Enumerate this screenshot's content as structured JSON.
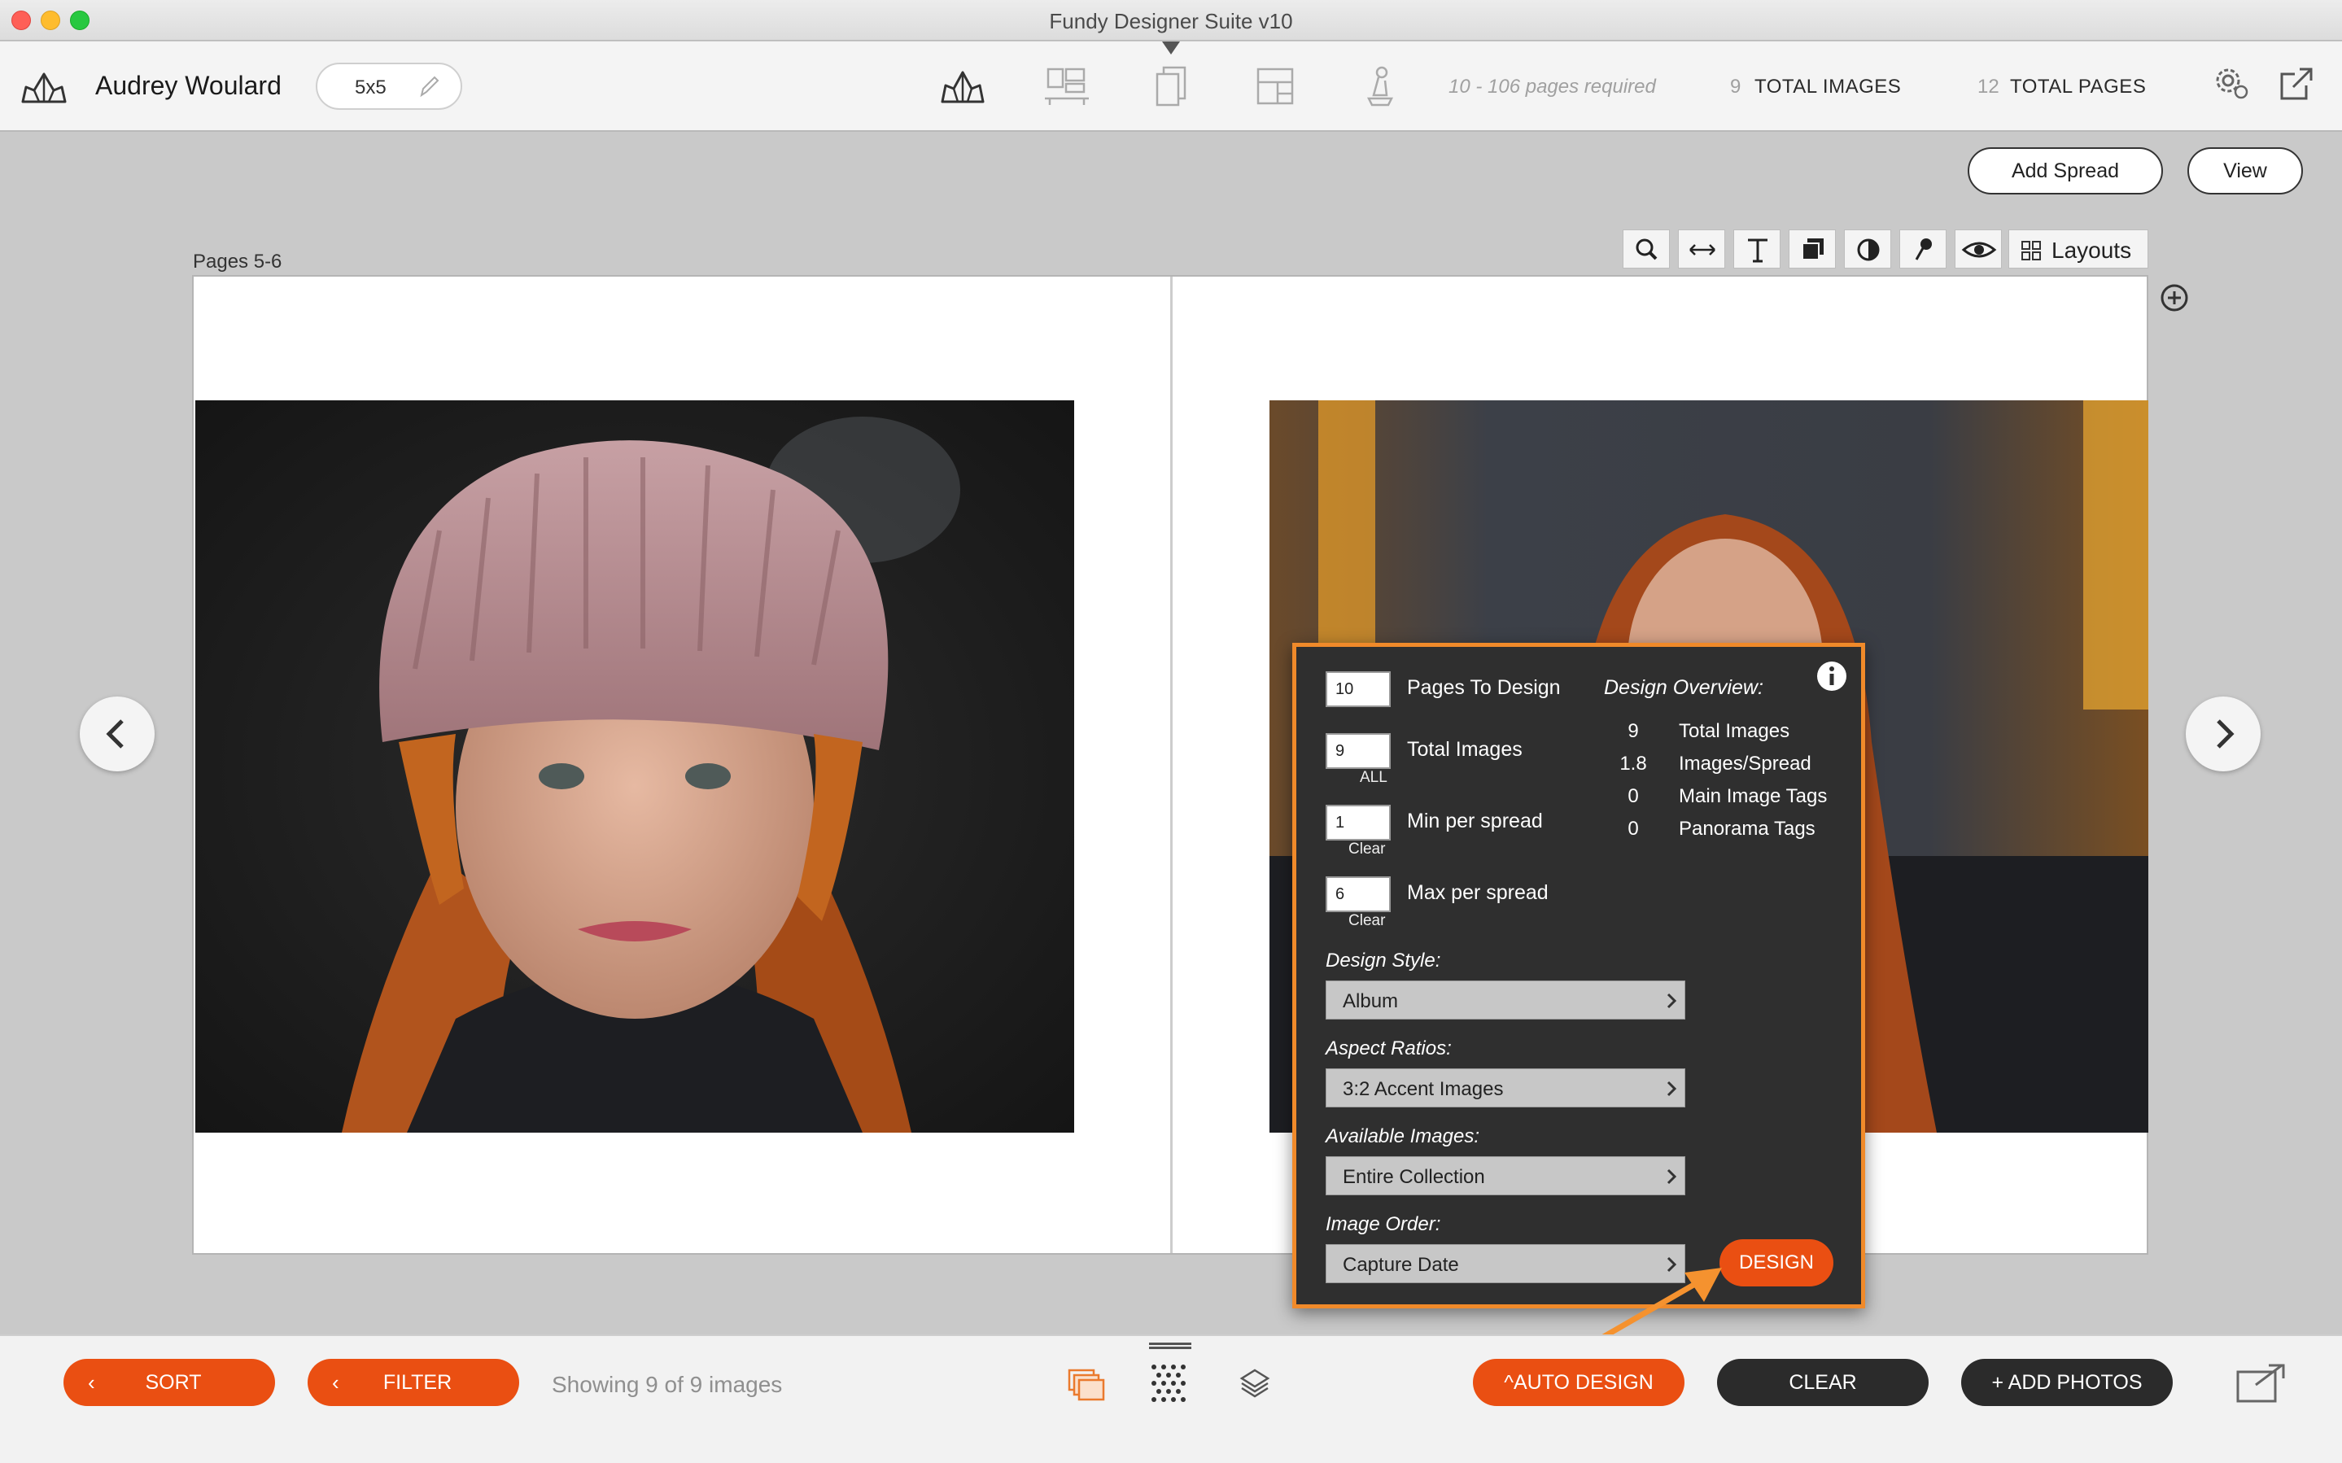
{
  "window": {
    "title": "Fundy Designer Suite v10"
  },
  "toolbar": {
    "client_name": "Audrey Woulard",
    "album_size": "5x5",
    "pages_required": "10 - 106 pages required",
    "total_images_count": "9",
    "total_images_label": "TOTAL IMAGES",
    "total_pages_count": "12",
    "total_pages_label": "TOTAL PAGES",
    "icons": [
      "album-designer-icon",
      "wall-art-icon",
      "proofing-icon",
      "cards-icon",
      "uploader-icon",
      "settings-icon",
      "export-icon"
    ]
  },
  "actions": {
    "add_spread": "Add Spread",
    "view": "View"
  },
  "spread": {
    "label": "Pages 5-6"
  },
  "tools": {
    "layouts_label": "Layouts",
    "icons": [
      "zoom-icon",
      "swap-icon",
      "text-icon",
      "layer-icon",
      "color-icon",
      "pin-icon",
      "eye-icon",
      "layouts-grid-icon"
    ]
  },
  "auto_design": {
    "pages_to_design": {
      "value": "10",
      "label": "Pages To Design"
    },
    "total_images": {
      "value": "9",
      "label": "Total Images",
      "sub": "ALL"
    },
    "min_per_spread": {
      "value": "1",
      "label": "Min per spread",
      "sub": "Clear"
    },
    "max_per_spread": {
      "value": "6",
      "label": "Max per spread",
      "sub": "Clear"
    },
    "overview": {
      "title": "Design Overview:",
      "rows": [
        {
          "value": "9",
          "label": "Total Images"
        },
        {
          "value": "1.8",
          "label": "Images/Spread"
        },
        {
          "value": "0",
          "label": "Main Image Tags"
        },
        {
          "value": "0",
          "label": "Panorama Tags"
        }
      ]
    },
    "design_style": {
      "label": "Design Style:",
      "value": "Album"
    },
    "aspect_ratios": {
      "label": "Aspect Ratios:",
      "value": "3:2 Accent Images"
    },
    "available_images": {
      "label": "Available Images:",
      "value": "Entire Collection"
    },
    "image_order": {
      "label": "Image Order:",
      "value": "Capture Date"
    },
    "design_button": "DESIGN"
  },
  "bottom": {
    "sort": "SORT",
    "filter": "FILTER",
    "showing": "Showing 9 of 9 images",
    "auto_design": "AUTO DESIGN",
    "clear": "CLEAR",
    "add_photos": "+ ADD PHOTOS"
  },
  "colors": {
    "accent": "#ea4f12",
    "panel_border": "#f08a2a",
    "panel_bg": "#2f2f2f",
    "dark_button": "#2b2b2b"
  }
}
